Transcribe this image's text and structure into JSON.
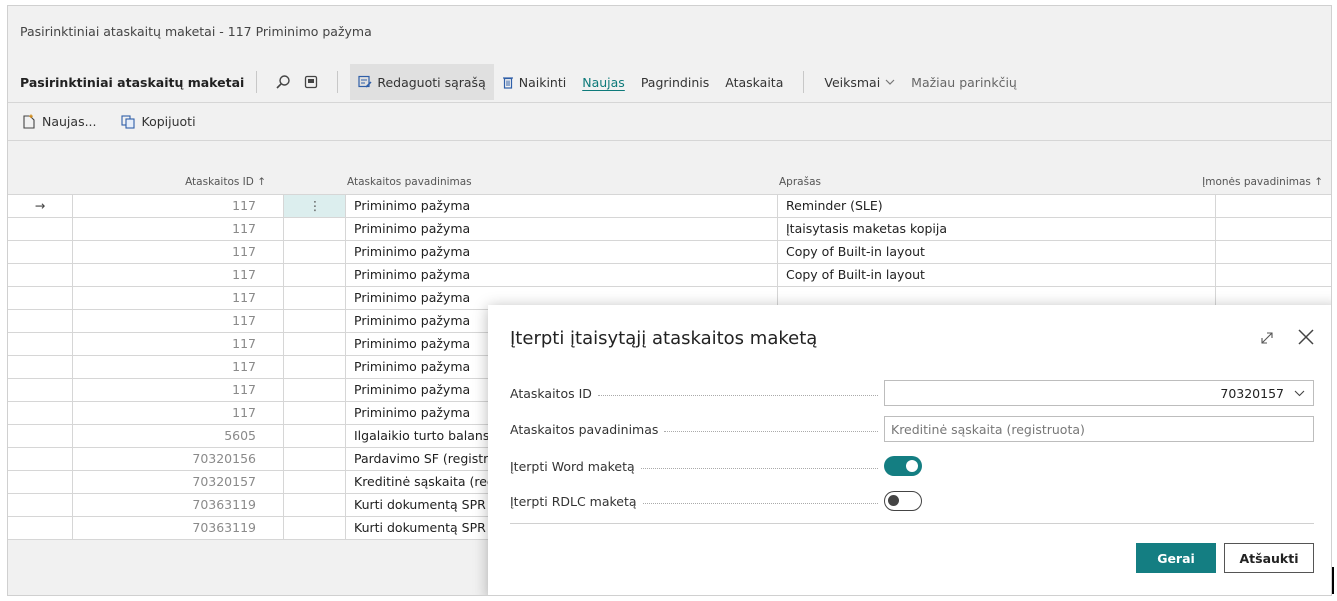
{
  "window": {
    "title": "Pasirinktiniai ataskaitų maketai - 117 Priminimo pažyma"
  },
  "action_bar": {
    "page_name": "Pasirinktiniai ataskaitų maketai",
    "edit_list": "Redaguoti sąrašą",
    "delete": "Naikinti",
    "new": "Naujas",
    "home": "Pagrindinis",
    "report": "Ataskaita",
    "actions": "Veiksmai",
    "fewer_options": "Mažiau parinkčių"
  },
  "sub_actions": {
    "new": "Naujas...",
    "copy": "Kopijuoti"
  },
  "grid": {
    "columns": {
      "report_id": "Ataskaitos ID ↑",
      "report_name": "Ataskaitos pavadinimas",
      "description": "Aprašas",
      "company": "Įmonės pavadinimas ↑"
    },
    "rows": [
      {
        "arrow": "→",
        "id": "117",
        "menu": "⋮",
        "name": "Priminimo pažyma",
        "desc": "Reminder (SLE)"
      },
      {
        "arrow": "",
        "id": "117",
        "menu": "",
        "name": "Priminimo pažyma",
        "desc": "Įtaisytasis maketas kopija"
      },
      {
        "arrow": "",
        "id": "117",
        "menu": "",
        "name": "Priminimo pažyma",
        "desc": "Copy of Built-in layout"
      },
      {
        "arrow": "",
        "id": "117",
        "menu": "",
        "name": "Priminimo pažyma",
        "desc": "Copy of Built-in layout"
      },
      {
        "arrow": "",
        "id": "117",
        "menu": "",
        "name": "Priminimo pažyma",
        "desc": ""
      },
      {
        "arrow": "",
        "id": "117",
        "menu": "",
        "name": "Priminimo pažyma",
        "desc": ""
      },
      {
        "arrow": "",
        "id": "117",
        "menu": "",
        "name": "Priminimo pažyma",
        "desc": ""
      },
      {
        "arrow": "",
        "id": "117",
        "menu": "",
        "name": "Priminimo pažyma",
        "desc": ""
      },
      {
        "arrow": "",
        "id": "117",
        "menu": "",
        "name": "Priminimo pažyma",
        "desc": ""
      },
      {
        "arrow": "",
        "id": "117",
        "menu": "",
        "name": "Priminimo pažyma",
        "desc": ""
      },
      {
        "arrow": "",
        "id": "5605",
        "menu": "",
        "name": "Ilgalaikio turto balans",
        "desc": ""
      },
      {
        "arrow": "",
        "id": "70320156",
        "menu": "",
        "name": "Pardavimo SF (registru",
        "desc": ""
      },
      {
        "arrow": "",
        "id": "70320157",
        "menu": "",
        "name": "Kreditinė sąskaita (reg",
        "desc": ""
      },
      {
        "arrow": "",
        "id": "70363119",
        "menu": "",
        "name": "Kurti dokumentą SPR",
        "desc": ""
      },
      {
        "arrow": "",
        "id": "70363119",
        "menu": "",
        "name": "Kurti dokumentą SPR",
        "desc": ""
      }
    ]
  },
  "dialog": {
    "title": "Įterpti įtaisytąjį ataskaitos maketą",
    "fields": {
      "report_id_label": "Ataskaitos ID",
      "report_id_value": "70320157",
      "report_name_label": "Ataskaitos pavadinimas",
      "report_name_value": "Kreditinė sąskaita (registruota)",
      "insert_word_label": "Įterpti Word maketą",
      "insert_word_on": true,
      "insert_rdlc_label": "Įterpti RDLC maketą",
      "insert_rdlc_on": false
    },
    "ok": "Gerai",
    "cancel": "Atšaukti"
  },
  "colors": {
    "accent": "#147e82",
    "link": "#0e7a7a"
  }
}
